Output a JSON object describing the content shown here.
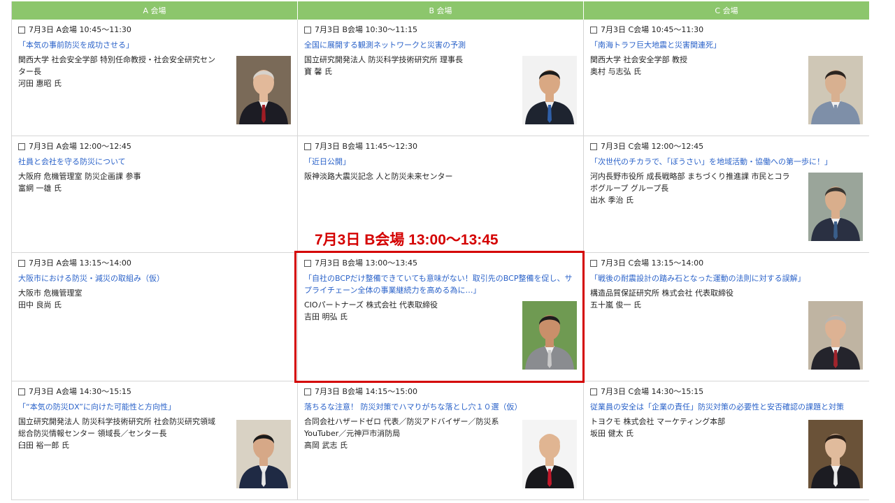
{
  "headers": [
    "A 会場",
    "B 会場",
    "C 会場"
  ],
  "sessions": [
    {
      "time": "7月3日 A会場 10:45～11:30",
      "title": "「本気の事前防災を成功させる」",
      "org": "関西大学 社会安全学部 特別任命教授・社会安全研究センター長",
      "name": "河田 惠昭 氏",
      "photo": "speaker-photo-suit-red-tie"
    },
    {
      "time": "7月3日 B会場 10:30～11:15",
      "title": "全国に展開する観測ネットワークと災害の予測",
      "org": "国立研究開発法人 防災科学技術研究所 理事長",
      "name": "寶 馨 氏",
      "photo": "speaker-photo-suit-blue-tie"
    },
    {
      "time": "7月3日 C会場 10:45～11:30",
      "title": "「南海トラフ巨大地震と災害関連死」",
      "org": "関西大学 社会安全学部 教授",
      "name": "奥村 与志弘 氏",
      "photo": "speaker-photo-glasses-shirt"
    },
    {
      "time": "7月3日 A会場 12:00～12:45",
      "title": "社員と会社を守る防災について",
      "org": "大阪府 危機管理室 防災企画課 参事",
      "name": "富網 一雄 氏",
      "photo": ""
    },
    {
      "time": "7月3日 B会場 11:45～12:30",
      "title": "「近日公開」",
      "org": "阪神淡路大震災記念 人と防災未来センター",
      "name": "",
      "photo": ""
    },
    {
      "time": "7月3日 C会場 12:00～12:45",
      "title": "「次世代のチカラで、「ぼうさい」を地域活動・協働への第一歩に！」",
      "org": "河内長野市役所 成長戦略部 まちづくり推進課 市民とコラボグループ グループ長",
      "name": "出水 季治 氏",
      "photo": "speaker-photo-glasses-outdoor"
    },
    {
      "time": "7月3日 A会場 13:15～14:00",
      "title": "大阪市における防災・減災の取組み（仮）",
      "org": "大阪市 危機管理室",
      "name": "田中 良尚 氏",
      "photo": ""
    },
    {
      "time": "7月3日 B会場 13:00～13:45",
      "title": "「自社のBCPだけ整備できていても意味がない！取引先のBCP整備を促し、サプライチェーン全体の事業継続力を高める為に…」",
      "org": "CIOパートナーズ 株式会社 代表取締役",
      "name": "吉田 明弘 氏",
      "photo": "speaker-photo-sunglasses-gray-suit"
    },
    {
      "time": "7月3日 C会場 13:15～14:00",
      "title": "「戦後の耐震設計の踏み石となった運動の法則に対する誤解」",
      "org": "構造品質保証研究所 株式会社 代表取締役",
      "name": "五十嵐 俊一 氏",
      "photo": "speaker-photo-gray-hair-suit"
    },
    {
      "time": "7月3日 A会場 14:30～15:15",
      "title": "「“本気の防災DX”に向けた可能性と方向性」",
      "org": "国立研究開発法人 防災科学技術研究所 社会防災研究領域 総合防災情報センター 領域長／センター長",
      "name": "臼田 裕一郎 氏",
      "photo": "speaker-photo-navy-suit"
    },
    {
      "time": "7月3日 B会場 14:15～15:00",
      "title": "落ちるな注意！ 防災対策でハマりがちな落とし穴１０選（仮）",
      "org": "合同会社ハザードゼロ 代表／防災アドバイザー／防災系YouTuber／元神戸市消防局",
      "name": "高岡 武志 氏",
      "photo": "speaker-photo-bald-red-tie"
    },
    {
      "time": "7月3日 C会場 14:30～15:15",
      "title": "従業員の安全は「企業の責任」防災対策の必要性と安否確認の課題と対策",
      "org": "トヨクモ 株式会社 マーケティング本部",
      "name": "坂田 健太 氏",
      "photo": "speaker-photo-young-dark-jacket"
    }
  ],
  "callout": "7月3日 B会場 13:00～13:45"
}
